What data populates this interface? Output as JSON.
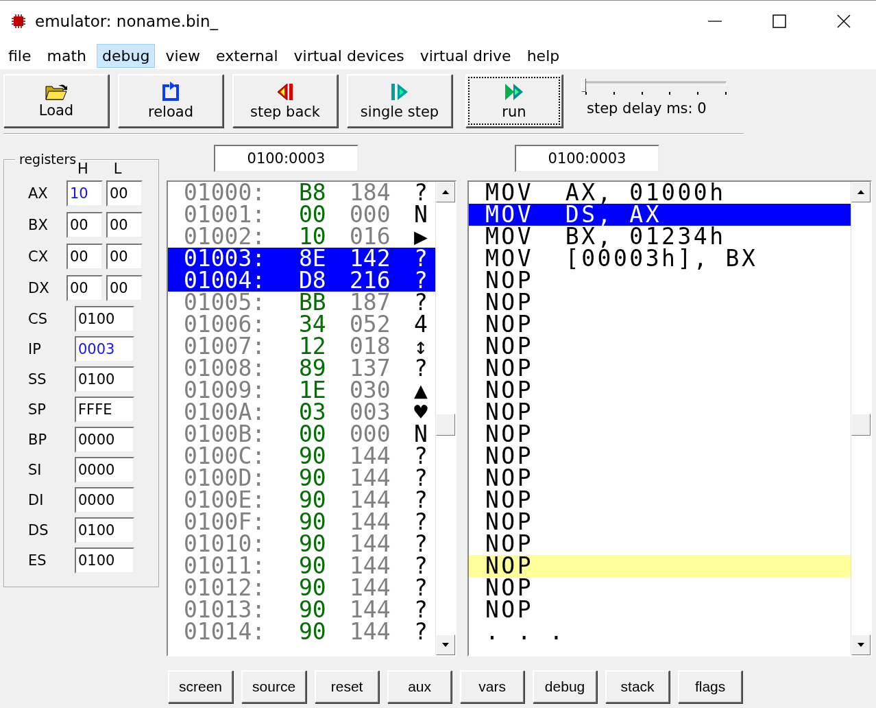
{
  "window": {
    "title": "emulator: noname.bin_"
  },
  "menu": [
    {
      "label": "file",
      "selected": false
    },
    {
      "label": "math",
      "selected": false
    },
    {
      "label": "debug",
      "selected": true
    },
    {
      "label": "view",
      "selected": false
    },
    {
      "label": "external",
      "selected": false
    },
    {
      "label": "virtual devices",
      "selected": false
    },
    {
      "label": "virtual drive",
      "selected": false
    },
    {
      "label": "help",
      "selected": false
    }
  ],
  "toolbar": [
    {
      "label": "Load",
      "kind": "load",
      "focused": false
    },
    {
      "label": "reload",
      "kind": "reload",
      "focused": false
    },
    {
      "label": "step back",
      "kind": "back",
      "focused": false
    },
    {
      "label": "single step",
      "kind": "step",
      "focused": false
    },
    {
      "label": "run",
      "kind": "run",
      "focused": true
    }
  ],
  "step_delay": {
    "label": "step delay ms: 0",
    "level": 0
  },
  "registers": {
    "title": "registers",
    "high_label": "H",
    "low_label": "L",
    "pairs": [
      {
        "name": "AX",
        "high": {
          "value": "10",
          "changed": true
        },
        "low": {
          "value": "00",
          "changed": false
        }
      },
      {
        "name": "BX",
        "high": {
          "value": "00",
          "changed": false
        },
        "low": {
          "value": "00",
          "changed": false
        }
      },
      {
        "name": "CX",
        "high": {
          "value": "00",
          "changed": false
        },
        "low": {
          "value": "00",
          "changed": false
        }
      },
      {
        "name": "DX",
        "high": {
          "value": "00",
          "changed": false
        },
        "low": {
          "value": "00",
          "changed": false
        }
      }
    ],
    "words": [
      {
        "name": "CS",
        "value": "0100",
        "changed": false
      },
      {
        "name": "IP",
        "value": "0003",
        "changed": true
      },
      {
        "name": "SS",
        "value": "0100",
        "changed": false
      },
      {
        "name": "SP",
        "value": "FFFE",
        "changed": false
      },
      {
        "name": "BP",
        "value": "0000",
        "changed": false
      },
      {
        "name": "SI",
        "value": "0000",
        "changed": false
      },
      {
        "name": "DI",
        "value": "0000",
        "changed": false
      },
      {
        "name": "DS",
        "value": "0100",
        "changed": false
      },
      {
        "name": "ES",
        "value": "0100",
        "changed": false
      }
    ]
  },
  "memory": {
    "address": "0100:0003",
    "rows": [
      {
        "address": "01000:",
        "hex": "B8",
        "dec": "184",
        "char": "?",
        "selected": false
      },
      {
        "address": "01001:",
        "hex": "00",
        "dec": "000",
        "char": "N",
        "selected": false
      },
      {
        "address": "01002:",
        "hex": "10",
        "dec": "016",
        "char": "▶",
        "selected": false
      },
      {
        "address": "01003:",
        "hex": "8E",
        "dec": "142",
        "char": "?",
        "selected": true
      },
      {
        "address": "01004:",
        "hex": "D8",
        "dec": "216",
        "char": "?",
        "selected": true
      },
      {
        "address": "01005:",
        "hex": "BB",
        "dec": "187",
        "char": "?",
        "selected": false
      },
      {
        "address": "01006:",
        "hex": "34",
        "dec": "052",
        "char": "4",
        "selected": false
      },
      {
        "address": "01007:",
        "hex": "12",
        "dec": "018",
        "char": "↕",
        "selected": false
      },
      {
        "address": "01008:",
        "hex": "89",
        "dec": "137",
        "char": "?",
        "selected": false
      },
      {
        "address": "01009:",
        "hex": "1E",
        "dec": "030",
        "char": "▲",
        "selected": false
      },
      {
        "address": "0100A:",
        "hex": "03",
        "dec": "003",
        "char": "♥",
        "selected": false
      },
      {
        "address": "0100B:",
        "hex": "00",
        "dec": "000",
        "char": "N",
        "selected": false
      },
      {
        "address": "0100C:",
        "hex": "90",
        "dec": "144",
        "char": "?",
        "selected": false
      },
      {
        "address": "0100D:",
        "hex": "90",
        "dec": "144",
        "char": "?",
        "selected": false
      },
      {
        "address": "0100E:",
        "hex": "90",
        "dec": "144",
        "char": "?",
        "selected": false
      },
      {
        "address": "0100F:",
        "hex": "90",
        "dec": "144",
        "char": "?",
        "selected": false
      },
      {
        "address": "01010:",
        "hex": "90",
        "dec": "144",
        "char": "?",
        "selected": false
      },
      {
        "address": "01011:",
        "hex": "90",
        "dec": "144",
        "char": "?",
        "selected": false
      },
      {
        "address": "01012:",
        "hex": "90",
        "dec": "144",
        "char": "?",
        "selected": false
      },
      {
        "address": "01013:",
        "hex": "90",
        "dec": "144",
        "char": "?",
        "selected": false
      },
      {
        "address": "01014:",
        "hex": "90",
        "dec": "144",
        "char": "?",
        "selected": false
      }
    ]
  },
  "disassembly": {
    "address": "0100:0003",
    "rows": [
      {
        "text": "MOV  AX, 01000h",
        "selected": false,
        "marked": false
      },
      {
        "text": "MOV  DS, AX",
        "selected": true,
        "marked": false
      },
      {
        "text": "MOV  BX, 01234h",
        "selected": false,
        "marked": false
      },
      {
        "text": "MOV  [00003h], BX",
        "selected": false,
        "marked": false
      },
      {
        "text": "NOP",
        "selected": false,
        "marked": false
      },
      {
        "text": "NOP",
        "selected": false,
        "marked": false
      },
      {
        "text": "NOP",
        "selected": false,
        "marked": false
      },
      {
        "text": "NOP",
        "selected": false,
        "marked": false
      },
      {
        "text": "NOP",
        "selected": false,
        "marked": false
      },
      {
        "text": "NOP",
        "selected": false,
        "marked": false
      },
      {
        "text": "NOP",
        "selected": false,
        "marked": false
      },
      {
        "text": "NOP",
        "selected": false,
        "marked": false
      },
      {
        "text": "NOP",
        "selected": false,
        "marked": false
      },
      {
        "text": "NOP",
        "selected": false,
        "marked": false
      },
      {
        "text": "NOP",
        "selected": false,
        "marked": false
      },
      {
        "text": "NOP",
        "selected": false,
        "marked": false
      },
      {
        "text": "NOP",
        "selected": false,
        "marked": false
      },
      {
        "text": "NOP",
        "selected": false,
        "marked": true
      },
      {
        "text": "NOP",
        "selected": false,
        "marked": false
      },
      {
        "text": "NOP",
        "selected": false,
        "marked": false
      },
      {
        "text": ". . .",
        "selected": false,
        "marked": false
      }
    ]
  },
  "bottom_buttons": [
    "screen",
    "source",
    "reset",
    "aux",
    "vars",
    "debug",
    "stack",
    "flags"
  ]
}
